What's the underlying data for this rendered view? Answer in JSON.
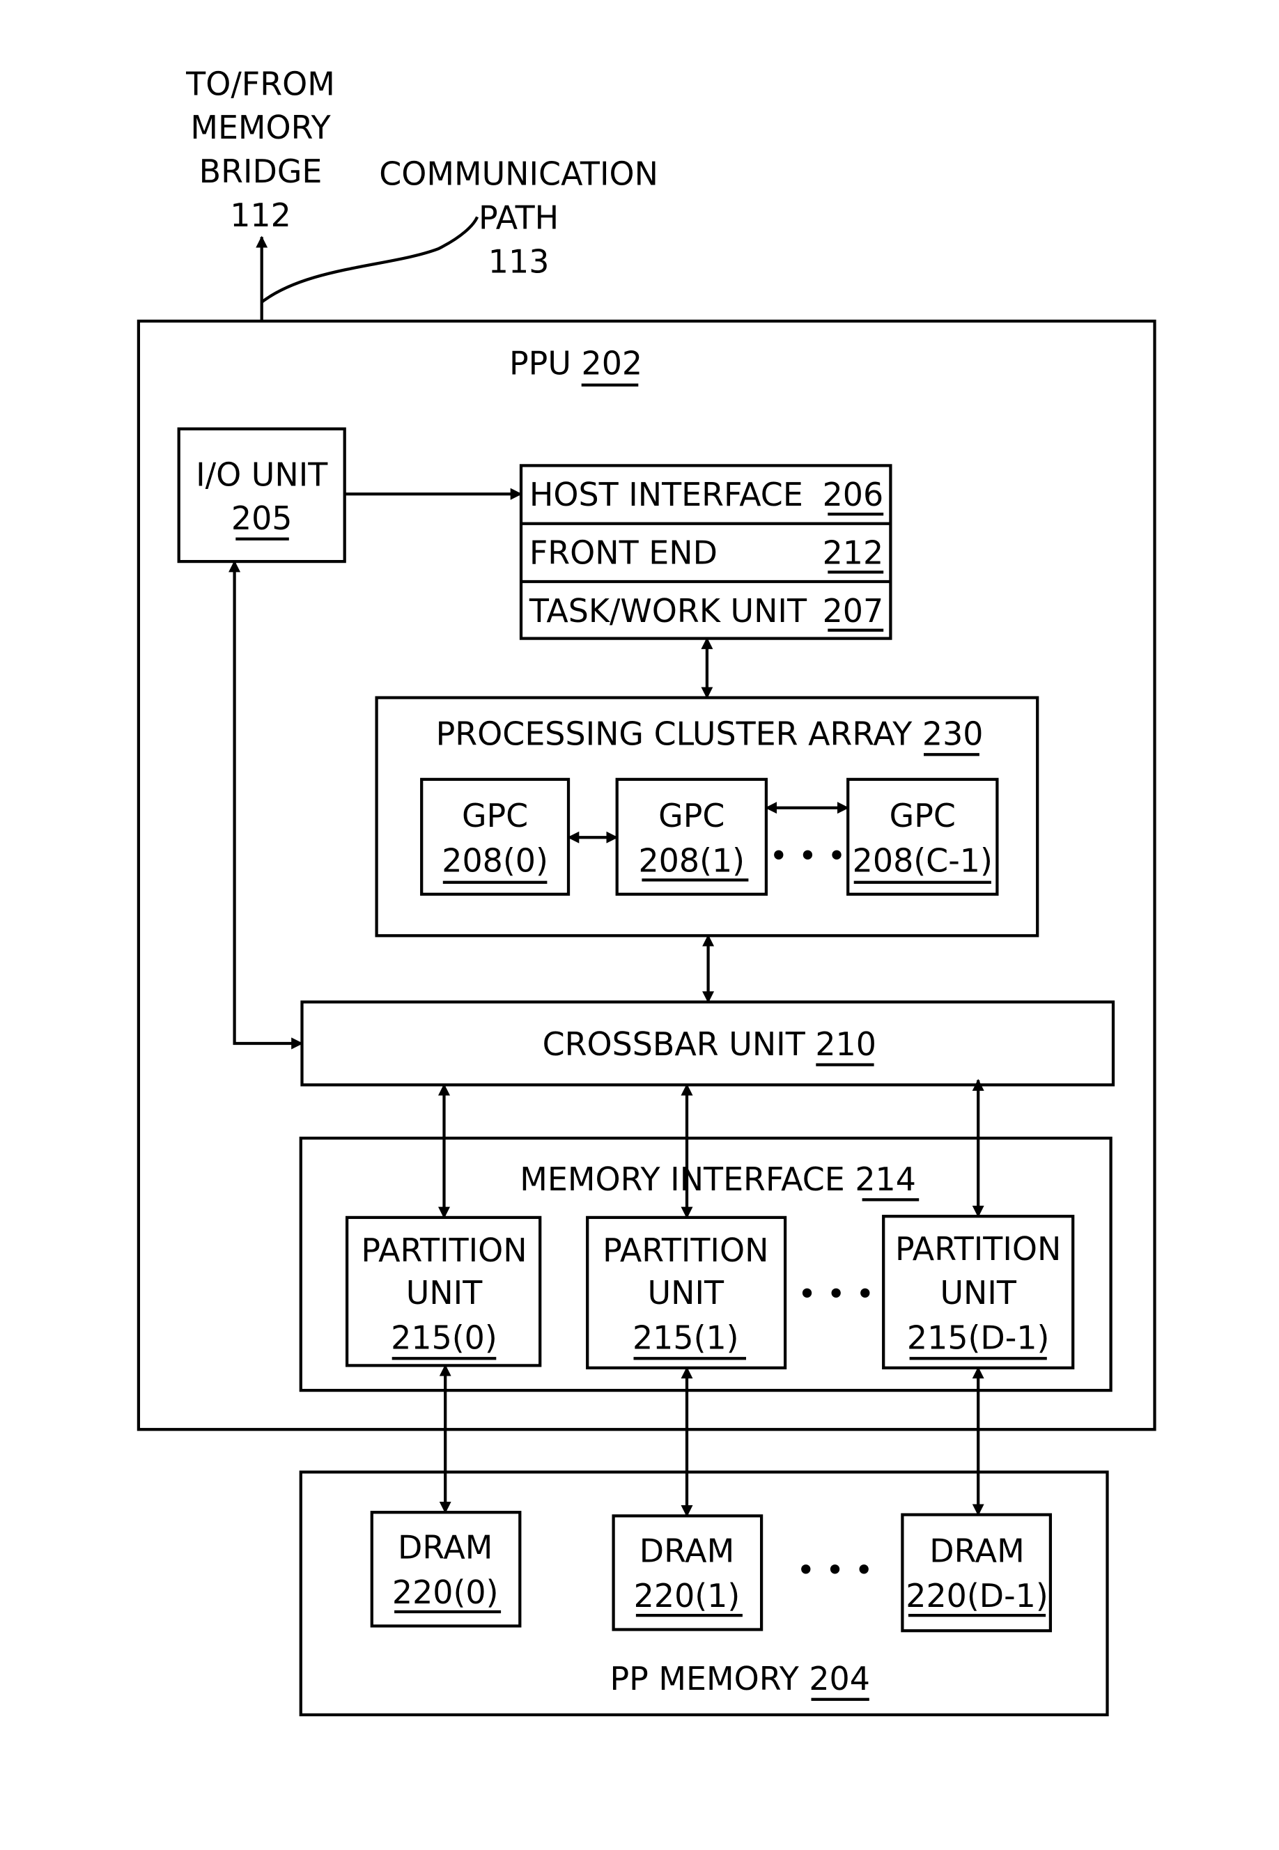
{
  "external": {
    "memory_bridge": [
      "TO/FROM",
      "MEMORY",
      "BRIDGE"
    ],
    "memory_bridge_ref": "112",
    "comm_path": [
      "COMMUNICATION",
      "PATH"
    ],
    "comm_path_ref": "113"
  },
  "ppu": {
    "label": "PPU",
    "ref": "202"
  },
  "io_unit": {
    "label": "I/O UNIT",
    "ref": "205"
  },
  "host_interface": {
    "label": "HOST INTERFACE",
    "ref": "206"
  },
  "front_end": {
    "label": "FRONT END",
    "ref": "212"
  },
  "task_work_unit": {
    "label": "TASK/WORK UNIT",
    "ref": "207"
  },
  "pca": {
    "label": "PROCESSING CLUSTER ARRAY",
    "ref": "230"
  },
  "gpcs": [
    {
      "label": "GPC",
      "ref": "208(0)"
    },
    {
      "label": "GPC",
      "ref": "208(1)"
    },
    {
      "label": "GPC",
      "ref": "208(C-1)"
    }
  ],
  "crossbar": {
    "label": "CROSSBAR UNIT",
    "ref": "210"
  },
  "memory_interface": {
    "label": "MEMORY INTERFACE",
    "ref": "214"
  },
  "partitions": [
    {
      "label1": "PARTITION",
      "label2": "UNIT",
      "ref": "215(0)"
    },
    {
      "label1": "PARTITION",
      "label2": "UNIT",
      "ref": "215(1)"
    },
    {
      "label1": "PARTITION",
      "label2": "UNIT",
      "ref": "215(D-1)"
    }
  ],
  "pp_memory": {
    "label": "PP MEMORY",
    "ref": "204"
  },
  "drams": [
    {
      "label": "DRAM",
      "ref": "220(0)"
    },
    {
      "label": "DRAM",
      "ref": "220(1)"
    },
    {
      "label": "DRAM",
      "ref": "220(D-1)"
    }
  ],
  "ellipsis": "• • •"
}
